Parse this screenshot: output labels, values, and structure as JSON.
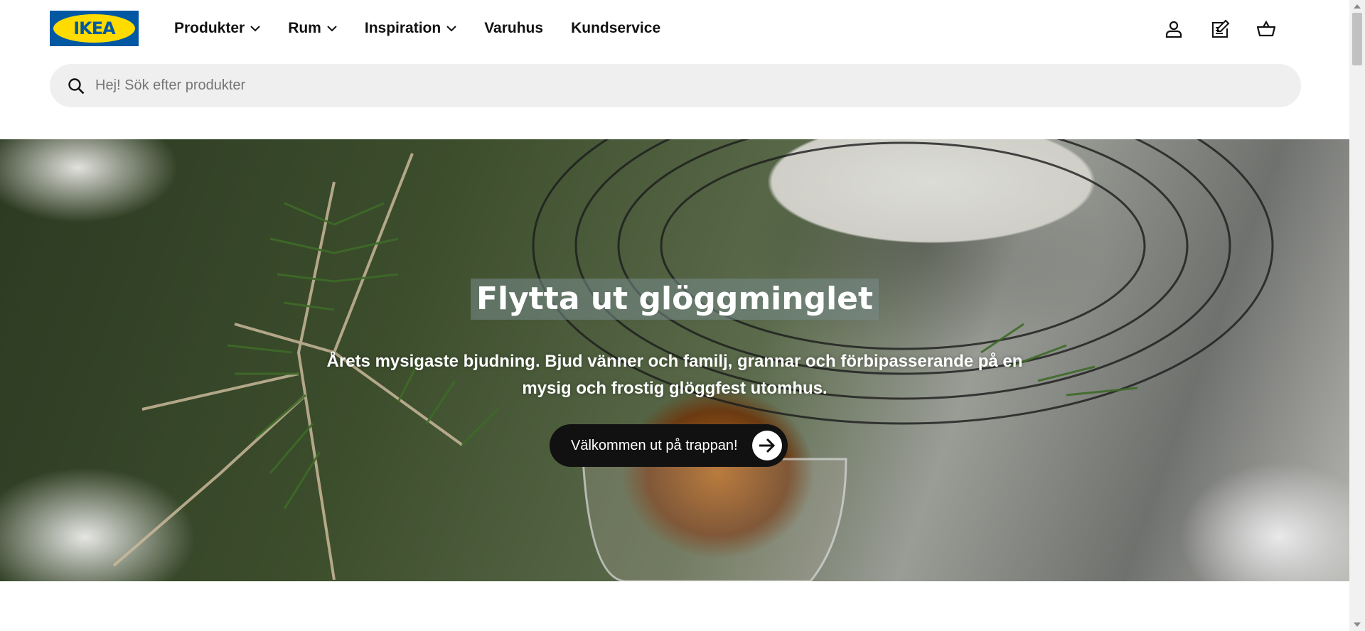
{
  "brand": {
    "logo_text": "IKEA",
    "primary_color": "#0058a3",
    "accent_color": "#ffdb00"
  },
  "nav": {
    "items": [
      {
        "label": "Produkter",
        "has_dropdown": true
      },
      {
        "label": "Rum",
        "has_dropdown": true
      },
      {
        "label": "Inspiration",
        "has_dropdown": true
      },
      {
        "label": "Varuhus",
        "has_dropdown": false
      },
      {
        "label": "Kundservice",
        "has_dropdown": false
      }
    ]
  },
  "header_actions": {
    "icons": [
      "user-icon",
      "shopping-list-icon",
      "cart-icon"
    ]
  },
  "search": {
    "placeholder": "Hej! Sök efter produkter",
    "value": ""
  },
  "hero": {
    "title": "Flytta ut glöggminglet",
    "subtitle": "Årets mysigaste bjudning. Bjud vänner och familj, grannar och förbipasserande på en mysig och frostig glöggfest utomhus.",
    "cta_label": "Välkommen ut på trappan!"
  }
}
